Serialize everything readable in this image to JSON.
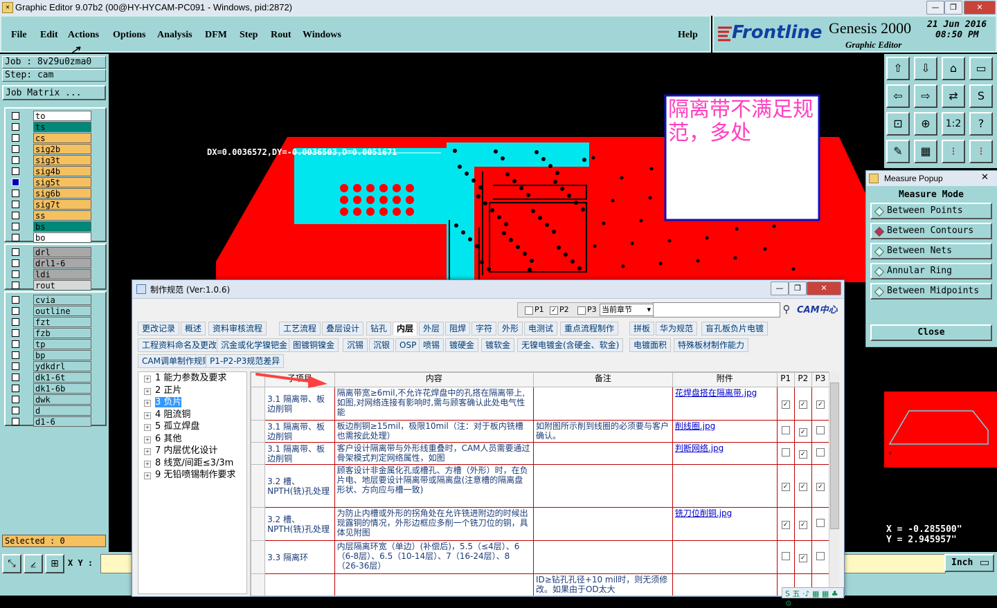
{
  "window": {
    "title": "Graphic Editor 9.07b2 (00@HY-HYCAM-PC091 - Windows, pid:2872)"
  },
  "menu": {
    "items": [
      "File",
      "Edit",
      "Actions",
      "Options",
      "Analysis",
      "DFM",
      "Step",
      "Rout",
      "Windows"
    ],
    "help": "Help"
  },
  "logo": {
    "brand": "Frontline",
    "product": "Genesis 2000",
    "subtitle": "Graphic Editor",
    "date": "21 Jun 2016",
    "time": "08:50 PM"
  },
  "job": {
    "job_label": "Job : 8v29u0zma0",
    "step_label": "Step: cam",
    "matrix_button": "Job Matrix ..."
  },
  "layers": {
    "group1": [
      {
        "name": "to",
        "color": "#ffffff"
      },
      {
        "name": "ts",
        "color": "#008878"
      },
      {
        "name": "cs",
        "color": "#f4c060"
      },
      {
        "name": "sig2b",
        "color": "#f4c060"
      },
      {
        "name": "sig3t",
        "color": "#f4c060"
      },
      {
        "name": "sig4b",
        "color": "#f4c060"
      },
      {
        "name": "sig5t",
        "color": "#f4c060",
        "selected": true
      },
      {
        "name": "sig6b",
        "color": "#f4c060"
      },
      {
        "name": "sig7t",
        "color": "#f4c060"
      },
      {
        "name": "ss",
        "color": "#f4c060"
      },
      {
        "name": "bs",
        "color": "#008878"
      },
      {
        "name": "bo",
        "color": "#ffffff"
      }
    ],
    "group2": [
      {
        "name": "drl",
        "color": "#a8a8a8"
      },
      {
        "name": "drl1-6",
        "color": "#a8a8a8"
      },
      {
        "name": "ldi",
        "color": "#a8a8a8"
      },
      {
        "name": "rout",
        "color": "#d8d8d8"
      }
    ],
    "group3": [
      {
        "name": "cvia",
        "color": "#a2d6d6"
      },
      {
        "name": "outline",
        "color": "#a2d6d6"
      },
      {
        "name": "fzt",
        "color": "#a2d6d6"
      },
      {
        "name": "fzb",
        "color": "#a2d6d6"
      },
      {
        "name": "tp",
        "color": "#a2d6d6"
      },
      {
        "name": "bp",
        "color": "#a2d6d6"
      },
      {
        "name": "ydkdrl",
        "color": "#a2d6d6"
      },
      {
        "name": "dk1-6t",
        "color": "#a2d6d6"
      },
      {
        "name": "dk1-6b",
        "color": "#a2d6d6"
      },
      {
        "name": "dwk",
        "color": "#a2d6d6"
      },
      {
        "name": "d",
        "color": "#a2d6d6"
      },
      {
        "name": "d1-6",
        "color": "#a2d6d6"
      }
    ]
  },
  "selected_label": "Selected : 0",
  "bottom": {
    "xy_label": "X Y :",
    "units": "Inch"
  },
  "canvas": {
    "measure_readout": "DX=0.0036572,DY=-0.0036503,D=0.0051671",
    "annotation": "隔离带不满足规范，多处"
  },
  "measure_popup": {
    "title": "Measure Popup",
    "heading": "Measure Mode",
    "options": [
      "Between Points",
      "Between Contours",
      "Between Nets",
      "Annular Ring",
      "Between Midpoints"
    ],
    "selected": "Between Contours",
    "close": "Close"
  },
  "coords": {
    "x": "X = -0.285500\"",
    "y": "Y = 2.945957\""
  },
  "dialog": {
    "title": "制作规范 (Ver:1.0.6)",
    "filter": {
      "p1": "P1",
      "p2": "P2",
      "p3": "P3",
      "select": "当前章节"
    },
    "brand": "CAM中心",
    "tabs_row1": [
      "更改记录",
      "概述",
      "资料审核流程",
      "工艺流程",
      "叠层设计",
      "钻孔",
      "内层",
      "外层",
      "阻焊",
      "字符",
      "外形",
      "电测试",
      "重点流程制作",
      "拼板",
      "华为规范",
      "盲孔板负片电镀"
    ],
    "tabs_row2": [
      "工程资料命名及更改",
      "沉金或化学镍钯金",
      "图镀铜镍金",
      "沉锡",
      "沉银",
      "OSP",
      "喷锡",
      "镀硬金",
      "镀软金",
      "无镍电镀金(含硬金、软金)",
      "电镀面积",
      "特殊板材制作能力"
    ],
    "tabs_row3": [
      "CAM调单制作规则",
      "P1-P2-P3规范差异"
    ],
    "active_tab": "内层",
    "tree": [
      "1 能力参数及要求",
      "2 正片",
      "3 负片",
      "4 阻流铜",
      "5 孤立焊盘",
      "6 其他",
      "7 内层优化设计",
      "8 线宽/间距≤3/3m",
      "9 无铅喷锡制作要求"
    ],
    "tree_selected": "3 负片",
    "columns": [
      "子项目",
      "内容",
      "备注",
      "附件",
      "P1",
      "P2",
      "P3"
    ],
    "rows": [
      {
        "item": "3.1 隔离带、板边削铜",
        "content": "隔离带宽≥6mil,不允许花焊盘中的孔搭在隔离带上,如图,对网络连接有影响时,需与顾客确认此处电气性能",
        "note": "",
        "attach": "花焊盘搭在隔离带.jpg",
        "p": [
          1,
          1,
          1
        ]
      },
      {
        "item": "3.1 隔离带、板边削铜",
        "content": "板边削铜≥15mil，极限10mil（注：对于板内铣槽也需按此处理）",
        "note": "如附图所示削到线圈的必须要与客户确认。",
        "attach": "削线圈.jpg",
        "p": [
          0,
          1,
          0
        ]
      },
      {
        "item": "3.1 隔离带、板边削铜",
        "content": "客户设计隔离带与外形线重叠时，CAM人员需要通过骨架模式判定网络属性，如图",
        "note": "",
        "attach": "判断网络.jpg",
        "p": [
          0,
          1,
          0
        ]
      },
      {
        "item": "3.2 槽、NPTH(铣)孔处理",
        "content": "顾客设计非金属化孔或槽孔、方槽（外形）时，在负片电、地层要设计隔离带或隔离盘(注意槽的隔离盘形状、方向应与槽一致)",
        "note": "",
        "attach": "",
        "p": [
          1,
          1,
          1
        ]
      },
      {
        "item": "3.2 槽、NPTH(铣)孔处理",
        "content": "为防止内槽或外形的拐角处在允许铣进附边的时候出现露铜的情况，外形边框应多削一个铣刀位的铜，具体见附图",
        "note": "",
        "attach": "铣刀位削铜.jpg",
        "p": [
          1,
          1,
          0
        ]
      },
      {
        "item": "3.3 隔离环",
        "content": "内层隔离环宽（单边）(补偿后)，5.5（≤4层）、6（6-8层）、6.5（10-14层）、7（16-24层）、8（26-36层）",
        "note": "",
        "attach": "",
        "p": [
          0,
          1,
          0
        ]
      },
      {
        "item": "",
        "content": "",
        "note": "ID≥钻孔孔径+10 mil时，则无须修改。如果由于OD太大",
        "attach": "",
        "p": []
      }
    ]
  },
  "tray": {
    "ime": "五"
  }
}
